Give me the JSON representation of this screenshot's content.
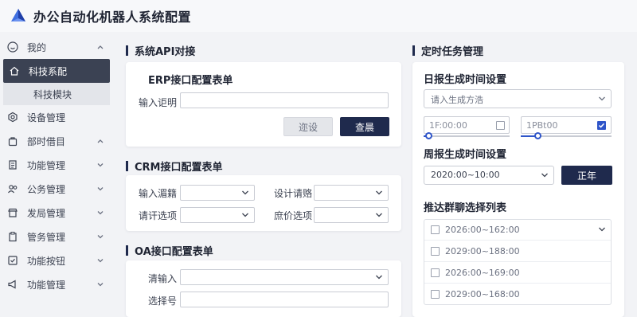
{
  "app": {
    "title": "办公自动化机器人系统配置"
  },
  "sidebar": {
    "items": [
      {
        "label": "我的",
        "icon": "smile-icon",
        "chev": "up"
      },
      {
        "label": "科技系配",
        "icon": "home-icon",
        "active": true
      },
      {
        "label": "科技模块",
        "sub": true
      },
      {
        "label": "设备管理",
        "icon": "hexagon-gear-icon"
      },
      {
        "label": "部时借目",
        "icon": "bag-icon",
        "chev": "up"
      },
      {
        "label": "功能管理",
        "icon": "document-icon",
        "chev": "down"
      },
      {
        "label": "公务管理",
        "icon": "users-icon",
        "chev": "down"
      },
      {
        "label": "发局管理",
        "icon": "shop-icon",
        "chev": "down"
      },
      {
        "label": "管务管理",
        "icon": "clipboard-icon",
        "chev": "down"
      },
      {
        "label": "功能按钮",
        "icon": "check-square-icon",
        "chev": "down"
      },
      {
        "label": "功能管理",
        "icon": "megaphone-icon",
        "chev": "down"
      }
    ]
  },
  "sections": {
    "api": "系统API对接",
    "crm": "CRM接口配置表单",
    "oa": "OA接口配置表单",
    "tasks": "定时任务管理"
  },
  "erp": {
    "title": "ERP接口配置表单",
    "field_label": "输入讵明",
    "btn_secondary": "迩设",
    "btn_primary": "查晨"
  },
  "crm": {
    "f1": "输入湄籍",
    "f2": "设计请赂",
    "f3": "请讦选项",
    "f4": "庶价选项"
  },
  "oa": {
    "f1": "清输入",
    "f2": "选择号"
  },
  "tasks": {
    "daily_title": "日报生成时间设置",
    "daily_placeholder": "请入生成方浩",
    "time1": "1F:00:00",
    "time2": "1PBt00",
    "slider1": 0.06,
    "slider2": 0.18,
    "weekly_title": "周报生成时间设置",
    "weekly_value": "2020:00~10:00",
    "weekly_btn": "正年",
    "group_title": "推达群聊选择列表",
    "groups": [
      "2026:00~162:00",
      "2029:00~188:00",
      "2026:00~169:00",
      "2029:00~168:00"
    ]
  },
  "colors": {
    "primary": "#1f2a4d",
    "accent": "#2f55c9",
    "active_nav": "#3b4253"
  }
}
